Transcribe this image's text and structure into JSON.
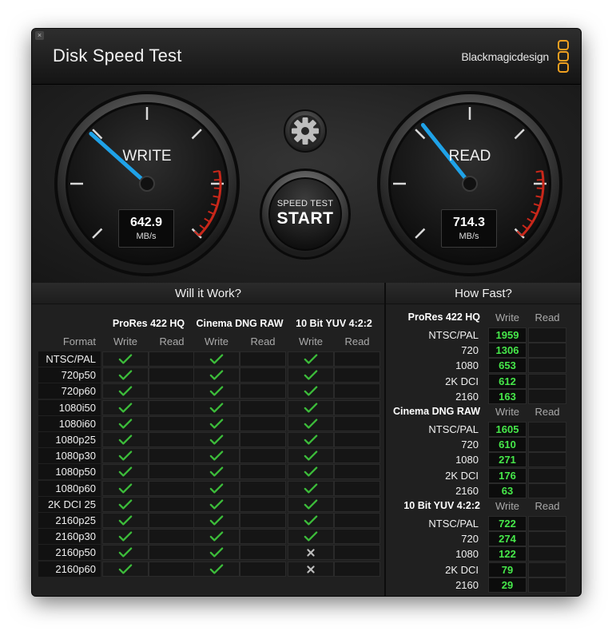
{
  "window": {
    "title": "Disk Speed Test",
    "brand": "Blackmagicdesign",
    "close_glyph": "×"
  },
  "colors": {
    "needle": "#1fa2e8",
    "check": "#3cbc3a",
    "speed_value": "#46e84a",
    "redline": "#c8271a"
  },
  "gauges": {
    "write": {
      "label": "WRITE",
      "value": "642.9",
      "unit": "MB/s",
      "level": 642.9
    },
    "read": {
      "label": "READ",
      "value": "714.3",
      "unit": "MB/s",
      "level": 714.3
    }
  },
  "controls": {
    "settings_icon": "gear-icon",
    "start_small": "SPEED TEST",
    "start_big": "START"
  },
  "will_it_work": {
    "title": "Will it Work?",
    "format_header": "Format",
    "groups": [
      {
        "name": "ProRes 422 HQ",
        "write": "Write",
        "read": "Read"
      },
      {
        "name": "Cinema DNG RAW",
        "write": "Write",
        "read": "Read"
      },
      {
        "name": "10 Bit YUV 4:2:2",
        "write": "Write",
        "read": "Read"
      }
    ],
    "rows": [
      {
        "format": "NTSC/PAL",
        "write": [
          "check",
          "check",
          "check"
        ]
      },
      {
        "format": "720p50",
        "write": [
          "check",
          "check",
          "check"
        ]
      },
      {
        "format": "720p60",
        "write": [
          "check",
          "check",
          "check"
        ]
      },
      {
        "format": "1080i50",
        "write": [
          "check",
          "check",
          "check"
        ]
      },
      {
        "format": "1080i60",
        "write": [
          "check",
          "check",
          "check"
        ]
      },
      {
        "format": "1080p25",
        "write": [
          "check",
          "check",
          "check"
        ]
      },
      {
        "format": "1080p30",
        "write": [
          "check",
          "check",
          "check"
        ]
      },
      {
        "format": "1080p50",
        "write": [
          "check",
          "check",
          "check"
        ]
      },
      {
        "format": "1080p60",
        "write": [
          "check",
          "check",
          "check"
        ]
      },
      {
        "format": "2K DCI 25",
        "write": [
          "check",
          "check",
          "check"
        ]
      },
      {
        "format": "2160p25",
        "write": [
          "check",
          "check",
          "check"
        ]
      },
      {
        "format": "2160p30",
        "write": [
          "check",
          "check",
          "check"
        ]
      },
      {
        "format": "2160p50",
        "write": [
          "check",
          "check",
          "cross"
        ]
      },
      {
        "format": "2160p60",
        "write": [
          "check",
          "check",
          "cross"
        ]
      }
    ]
  },
  "how_fast": {
    "title": "How Fast?",
    "groups": [
      {
        "name": "ProRes 422 HQ",
        "write": "Write",
        "read": "Read",
        "rows": [
          {
            "format": "NTSC/PAL",
            "value": "1959"
          },
          {
            "format": "720",
            "value": "1306"
          },
          {
            "format": "1080",
            "value": "653"
          },
          {
            "format": "2K DCI",
            "value": "612"
          },
          {
            "format": "2160",
            "value": "163"
          }
        ]
      },
      {
        "name": "Cinema DNG RAW",
        "write": "Write",
        "read": "Read",
        "rows": [
          {
            "format": "NTSC/PAL",
            "value": "1605"
          },
          {
            "format": "720",
            "value": "610"
          },
          {
            "format": "1080",
            "value": "271"
          },
          {
            "format": "2K DCI",
            "value": "176"
          },
          {
            "format": "2160",
            "value": "63"
          }
        ]
      },
      {
        "name": "10 Bit YUV 4:2:2",
        "write": "Write",
        "read": "Read",
        "rows": [
          {
            "format": "NTSC/PAL",
            "value": "722"
          },
          {
            "format": "720",
            "value": "274"
          },
          {
            "format": "1080",
            "value": "122"
          },
          {
            "format": "2K DCI",
            "value": "79"
          },
          {
            "format": "2160",
            "value": "29"
          }
        ]
      }
    ]
  }
}
